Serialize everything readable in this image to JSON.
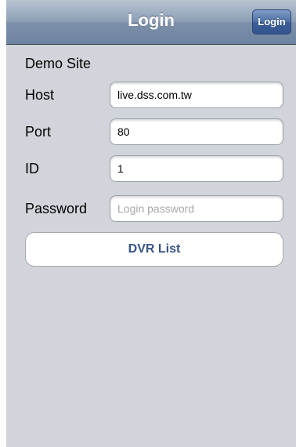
{
  "navbar": {
    "title": "Login",
    "login_button": "Login"
  },
  "site_name": "Demo Site",
  "form": {
    "host": {
      "label": "Host",
      "value": "live.dss.com.tw",
      "placeholder": ""
    },
    "port": {
      "label": "Port",
      "value": "80",
      "placeholder": ""
    },
    "id": {
      "label": "ID",
      "value": "1",
      "placeholder": ""
    },
    "password": {
      "label": "Password",
      "value": "",
      "placeholder": "Login password"
    }
  },
  "dvr_list_button": "DVR List",
  "colors": {
    "navbar_gradient_top": "#b9c4d2",
    "navbar_gradient_bottom": "#6d83a0",
    "nav_button": "#3c5f98",
    "background": "#d1d5db",
    "button_text": "#385487"
  }
}
